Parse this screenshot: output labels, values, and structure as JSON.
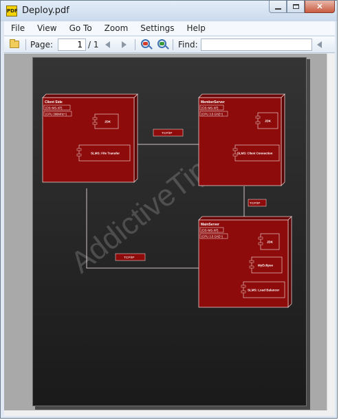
{
  "window": {
    "title": "Deploy.pdf",
    "icon": "PDF"
  },
  "menu": [
    "File",
    "View",
    "Go To",
    "Zoom",
    "Settings",
    "Help"
  ],
  "toolbar": {
    "page_label": "Page:",
    "page_value": "1",
    "page_total": "/ 1",
    "find_label": "Find:",
    "find_value": ""
  },
  "diagram": {
    "watermark": "AddictiveTips",
    "nodes": {
      "client": {
        "title": "Client Side",
        "stereo1": "{OS=MS-XP}",
        "stereo2": "{CPU 366MHz+}",
        "comp1": "JDK",
        "comp2": "SLMS: File Transfer"
      },
      "member": {
        "title": "MemberServer",
        "stereo1": "{OS=MS-XP}",
        "stereo2": "{CPU 3.5 GHZ+}",
        "comp1": "JDK",
        "comp2": "SLMS: Client Connection"
      },
      "main": {
        "title": "MainServer",
        "stereo1": "{OS=MS-XP}",
        "stereo2": "{CPU 3.5 GHZ+}",
        "comp1": "JDK",
        "comp2": "MyEclipse",
        "comp3": "SLMS: Load Balancer"
      }
    },
    "links": {
      "top": "TCP/IP",
      "right": "TCP/IP",
      "bottom": "TCP/IP"
    },
    "colors": {
      "node": "#8e0b0b",
      "node_side": "#6a0606",
      "line": "#d7b5b5"
    }
  }
}
